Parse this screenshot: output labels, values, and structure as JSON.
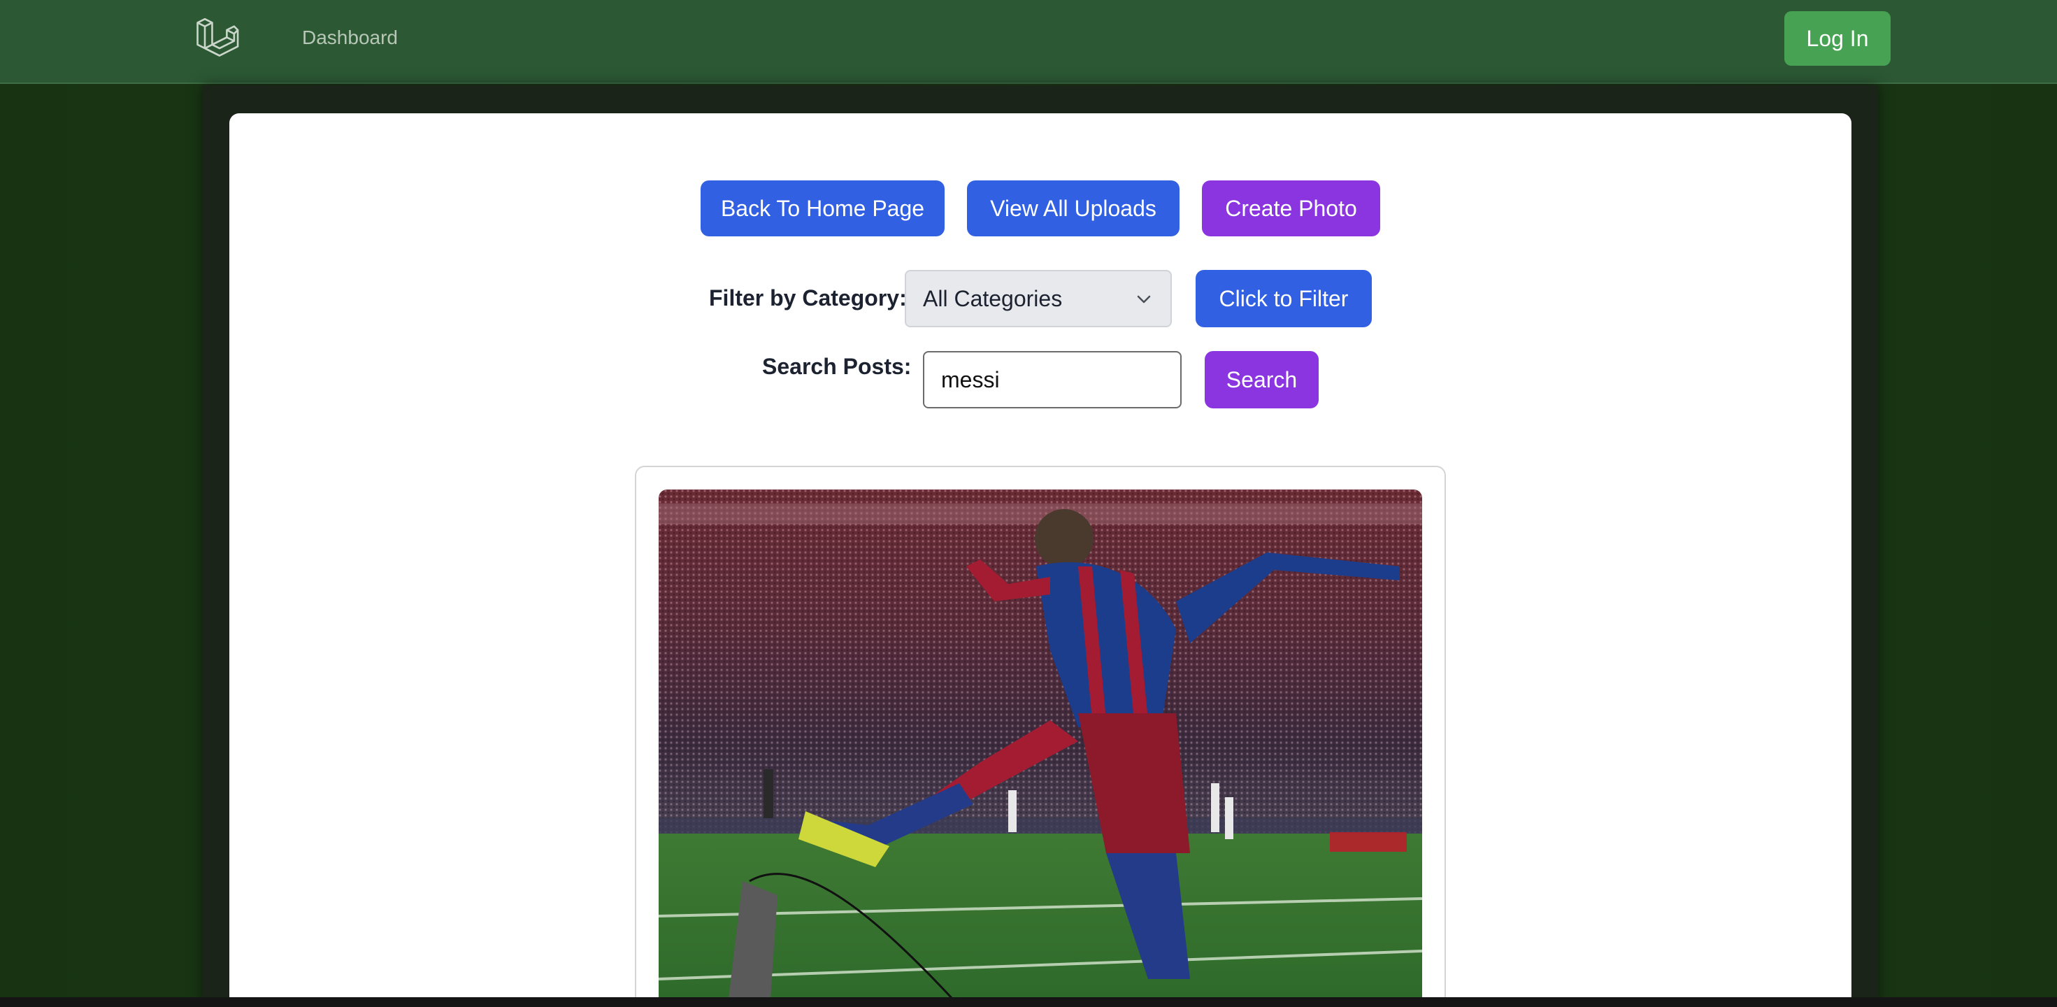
{
  "nav": {
    "dashboard_label": "Dashboard",
    "login_label": "Log In",
    "logo_icon": "laravel-logo-icon"
  },
  "actions": {
    "back_label": "Back To Home Page",
    "view_uploads_label": "View All Uploads",
    "create_photo_label": "Create Photo"
  },
  "filter": {
    "label": "Filter by Category:",
    "selected": "All Categories",
    "button_label": "Click to Filter"
  },
  "search": {
    "label": "Search Posts:",
    "value": "messi",
    "button_label": "Search"
  },
  "colors": {
    "navbar": "#2c5834",
    "login": "#47a353",
    "blue_button": "#3160e2",
    "purple_button": "#8a35e0"
  }
}
